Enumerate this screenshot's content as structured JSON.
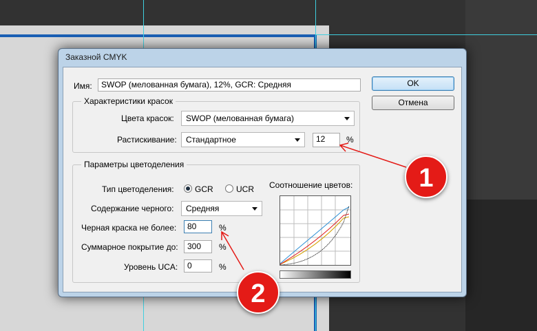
{
  "dialog": {
    "title": "Заказной CMYK",
    "name_label": "Имя:",
    "name_value": "SWOP (мелованная бумага), 12%, GCR: Средняя",
    "ok_label": "OK",
    "cancel_label": "Отмена"
  },
  "ink_group": {
    "title": "Характеристики красок",
    "ink_colors_label": "Цвета красок:",
    "ink_colors_value": "SWOP (мелованная бумага)",
    "dot_gain_label": "Растискивание:",
    "dot_gain_mode": "Стандартное",
    "dot_gain_value": "12",
    "dot_gain_unit": "%"
  },
  "separation_group": {
    "title": "Параметры цветоделения",
    "type_label": "Тип цветоделения:",
    "gcr_label": "GCR",
    "ucr_label": "UCR",
    "selected_type": "GCR",
    "black_gen_label": "Содержание черного:",
    "black_gen_value": "Средняя",
    "black_limit_label": "Черная краска не более:",
    "black_limit_value": "80",
    "black_limit_unit": "%",
    "total_ink_label": "Суммарное покрытие до:",
    "total_ink_value": "300",
    "total_ink_unit": "%",
    "uca_label": "Уровень UCA:",
    "uca_value": "0",
    "uca_unit": "%",
    "graph_label": "Соотношение цветов:"
  },
  "annotations": {
    "badge1": "1",
    "badge2": "2",
    "color": "#e41b17"
  },
  "colors": {
    "cyan_curve": "#2a8fd6",
    "magenta_curve": "#e02020",
    "yellow_curve": "#d4a000",
    "black_curve": "#000000"
  }
}
